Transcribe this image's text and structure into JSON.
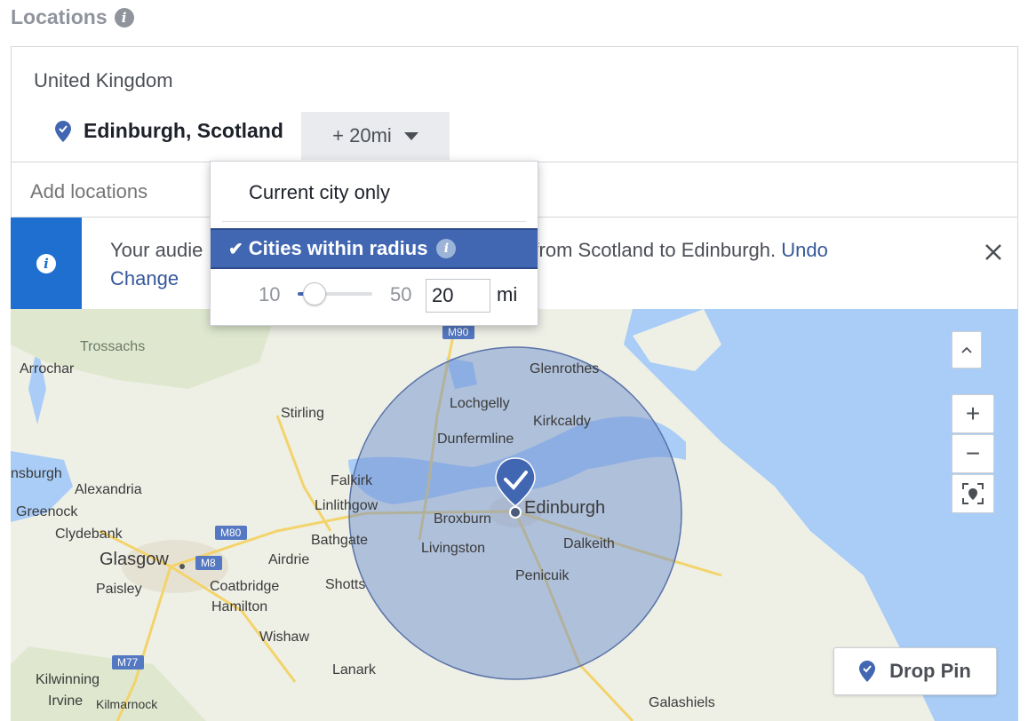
{
  "section": {
    "title": "Locations",
    "info_icon": "info-icon"
  },
  "location": {
    "country": "United Kingdom",
    "city": "Edinburgh, Scotland",
    "radius_label": "+ 20mi",
    "add_placeholder": "Add locations"
  },
  "notice": {
    "text_start": "Your audie",
    "text_end": "from Scotland to Edinburgh.",
    "undo": "Undo",
    "change": "Change"
  },
  "dropdown": {
    "option_current": "Current city only",
    "option_radius": "Cities within radius",
    "min": "10",
    "max": "50",
    "value": "20",
    "value_fraction": 0.25,
    "unit": "mi"
  },
  "map": {
    "drop_pin": "Drop Pin",
    "zoom_in": "+",
    "zoom_out": "−",
    "labels": {
      "trossachs": "Trossachs",
      "arrochar": "Arrochar",
      "glenrothes": "Glenrothes",
      "lochgelly": "Lochgelly",
      "kirkcaldy": "Kirkcaldy",
      "stirling": "Stirling",
      "dunfermline": "Dunfermline",
      "helensburgh": "nsburgh",
      "alexandria": "Alexandria",
      "falkirk": "Falkirk",
      "greenock": "Greenock",
      "linlithgow": "Linlithgow",
      "edinburgh": "Edinburgh",
      "broxburn": "Broxburn",
      "clydebank": "Clydebank",
      "bathgate": "Bathgate",
      "livingston": "Livingston",
      "dalkeith": "Dalkeith",
      "glasgow": "Glasgow",
      "airdrie": "Airdrie",
      "paisley": "Paisley",
      "coatbridge": "Coatbridge",
      "shotts": "Shotts",
      "penicuik": "Penicuik",
      "hamilton": "Hamilton",
      "wishaw": "Wishaw",
      "lanark": "Lanark",
      "kilwinning": "Kilwinning",
      "irvine": "Irvine",
      "kilmarnock": "Kilmarnock",
      "galashiels": "Galashiels",
      "m90": "M90",
      "m80": "M80",
      "m8": "M8",
      "m77": "M77"
    }
  },
  "colors": {
    "accent": "#4267b2",
    "notice": "#1f6fd1",
    "link": "#365899",
    "water": "#a9cdf7",
    "land": "#eef0e6",
    "radius_fill": "#6f8fce"
  }
}
